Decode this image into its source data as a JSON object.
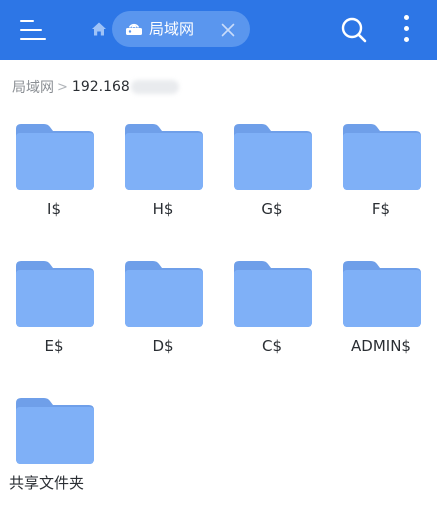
{
  "header": {
    "menu_icon": "menu-icon",
    "home_icon": "home-icon",
    "tab": {
      "label": "局域网",
      "icon": "network-drive-icon",
      "close_icon": "close-icon"
    },
    "search_icon": "search-icon",
    "more_icon": "more-vertical-icon",
    "bar_color": "#2d76e6"
  },
  "breadcrumb": {
    "root": "局域网",
    "separator": ">",
    "current": "192.168"
  },
  "folders": [
    {
      "name": "I$"
    },
    {
      "name": "H$"
    },
    {
      "name": "G$"
    },
    {
      "name": "F$"
    },
    {
      "name": "E$"
    },
    {
      "name": "D$"
    },
    {
      "name": "C$"
    },
    {
      "name": "ADMIN$"
    },
    {
      "name": "共享文件夹"
    }
  ],
  "folder_color": "#7fb0f7"
}
